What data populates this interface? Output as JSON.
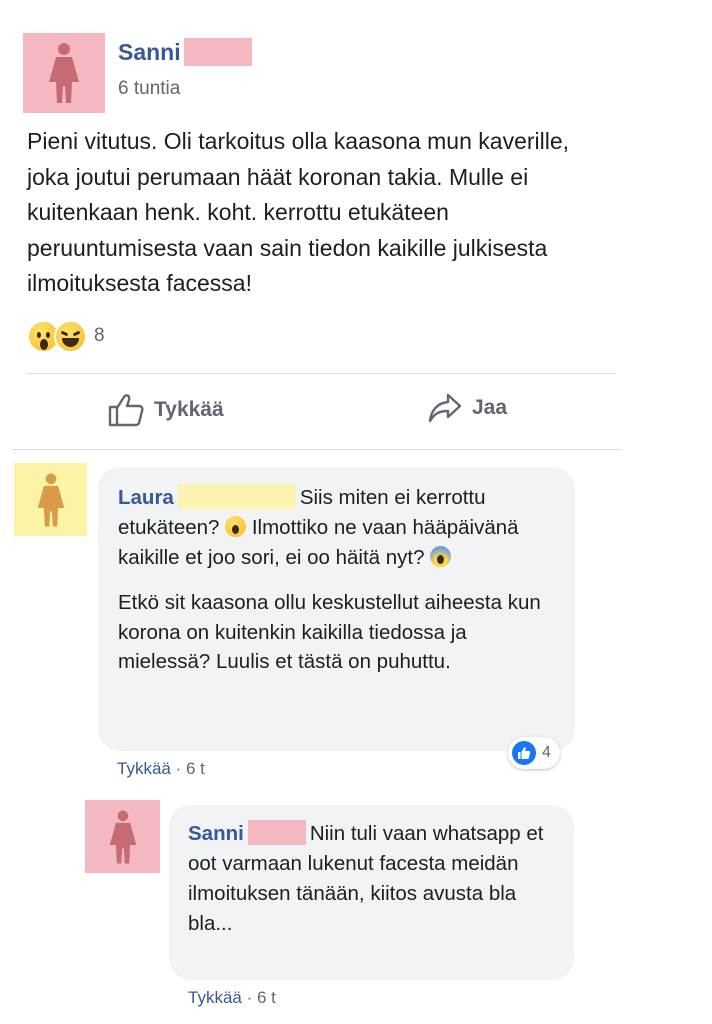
{
  "post": {
    "author": "Sanni",
    "time": "6 tuntia",
    "text": "Pieni vitutus. Oli tarkoitus olla kaasona mun kaverille, joka joutui perumaan häät koronan takia. Mulle ei kuitenkaan henk. koht. kerrottu etukäteen peruuntumisesta vaan sain tiedon kaikille julkisesta ilmoituksesta facessa!",
    "reactions": {
      "icons": [
        "wow-icon",
        "haha-icon"
      ],
      "count": "8"
    },
    "actions": {
      "like": "Tykkää",
      "share": "Jaa"
    }
  },
  "comments": [
    {
      "author": "Laura",
      "p1_a": "Siis miten ei kerrottu etukäteen?",
      "p1_b": "Ilmottiko ne vaan hääpäivänä kaikille et joo sori, ei oo häitä nyt?",
      "p2": "Etkö sit kaasona ollu keskustellut aiheesta kun korona on kuitenkin kaikilla tiedossa ja mielessä? Luulis et tästä on puhuttu.",
      "like_count": "4",
      "like_link": "Tykkää",
      "time": "6 t"
    },
    {
      "author": "Sanni",
      "text": "Niin tuli vaan whatsapp et oot varmaan lukenut facesta meidän ilmoituksen tänään, kiitos avusta bla bla...",
      "like_link": "Tykkää",
      "time": "6 t"
    }
  ],
  "colors": {
    "avatar_pink": "#f3b8c0",
    "avatar_yellow": "#fbf4a7",
    "name_blue": "#385898",
    "bubble_gray": "#f2f3f5"
  }
}
